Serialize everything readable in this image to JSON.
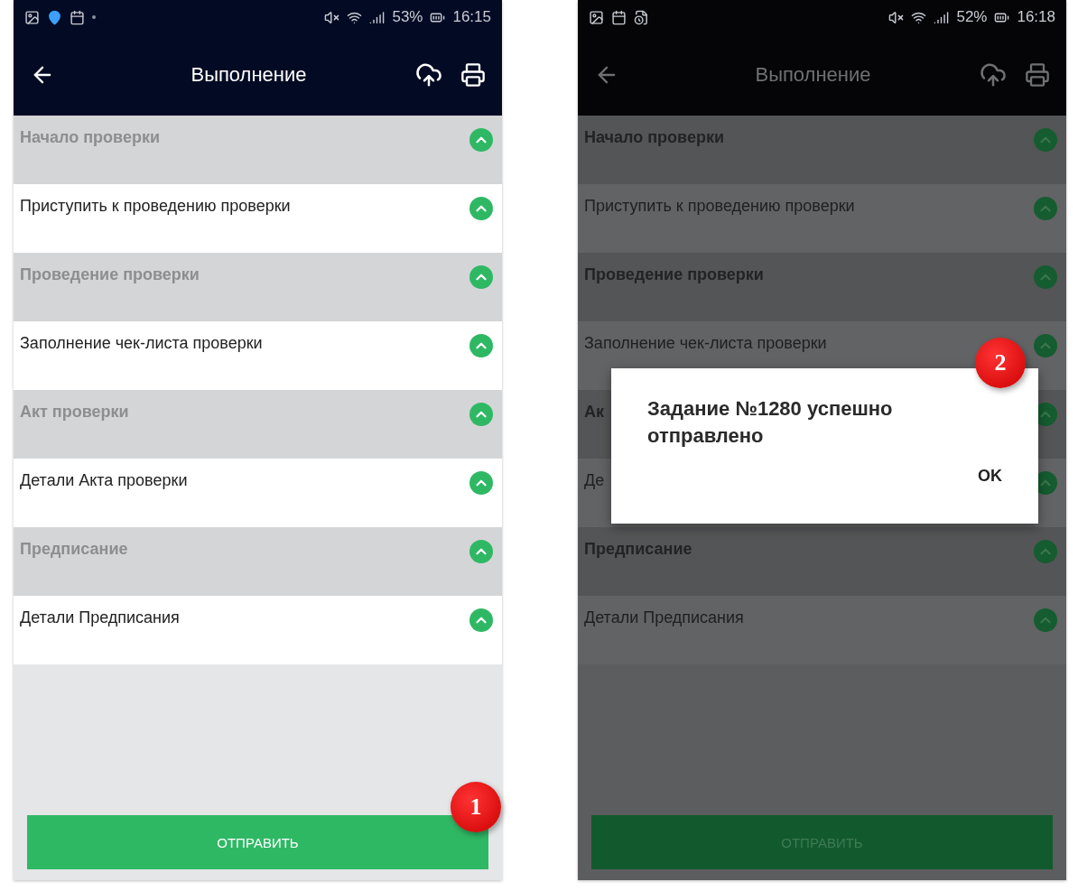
{
  "screens": [
    {
      "dimmed": false,
      "status_bar": {
        "battery": "53%",
        "time": "16:15"
      },
      "title": "Выполнение",
      "rows": [
        {
          "kind": "header",
          "label": "Начало проверки"
        },
        {
          "kind": "item",
          "label": "Приступить к проведению проверки"
        },
        {
          "kind": "header",
          "label": "Проведение проверки"
        },
        {
          "kind": "item",
          "label": "Заполнение чек-листа проверки"
        },
        {
          "kind": "header",
          "label": "Акт проверки"
        },
        {
          "kind": "item",
          "label": "Детали Акта проверки"
        },
        {
          "kind": "header",
          "label": "Предписание"
        },
        {
          "kind": "item",
          "label": "Детали Предписания"
        }
      ],
      "button": "ОТПРАВИТЬ",
      "badge": "1"
    },
    {
      "dimmed": true,
      "status_bar": {
        "battery": "52%",
        "time": "16:18"
      },
      "title": "Выполнение",
      "rows": [
        {
          "kind": "header",
          "label": "Начало проверки"
        },
        {
          "kind": "item",
          "label": "Приступить к проведению проверки"
        },
        {
          "kind": "header",
          "label": "Проведение проверки"
        },
        {
          "kind": "item",
          "label": "Заполнение чек-листа проверки"
        },
        {
          "kind": "header",
          "label": "Ак"
        },
        {
          "kind": "item",
          "label": "Де"
        },
        {
          "kind": "header",
          "label": "Предписание"
        },
        {
          "kind": "item",
          "label": "Детали Предписания"
        }
      ],
      "button": "ОТПРАВИТЬ",
      "dialog": {
        "message": "Задание №1280 успешно отправлено",
        "button": "OK",
        "badge": "2"
      }
    }
  ]
}
